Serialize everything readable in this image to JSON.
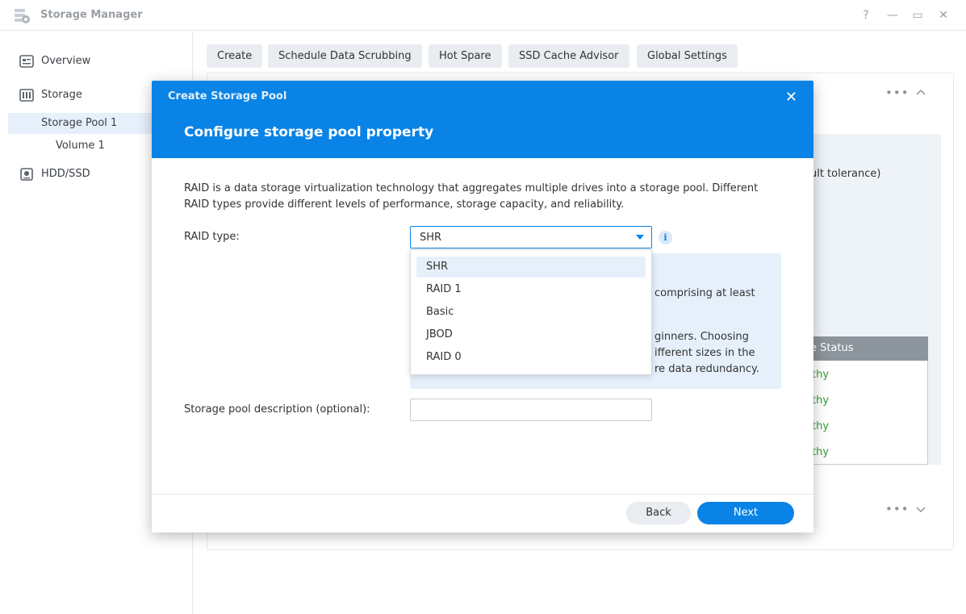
{
  "window": {
    "title": "Storage Manager",
    "controls": {
      "help": "?",
      "minimize": "—",
      "maximize": "▭",
      "close": "✕"
    }
  },
  "sidebar": {
    "overview": "Overview",
    "storage": "Storage",
    "storage_pool": "Storage Pool 1",
    "volume": "Volume 1",
    "hdd": "HDD/SSD"
  },
  "toolbar": {
    "create": "Create",
    "scrubbing": "Schedule Data Scrubbing",
    "hot_spare": "Hot Spare",
    "ssd_cache": "SSD Cache Advisor",
    "global_settings": "Global Settings"
  },
  "background": {
    "fault_tolerance_fragment": "ault tolerance)",
    "status_header_fragment": "e Status",
    "healthy_fragment": "thy",
    "dots": "•••"
  },
  "modal": {
    "small_title": "Create Storage Pool",
    "title": "Configure storage pool property",
    "close": "✕",
    "description": "RAID is a data storage virtualization technology that aggregates multiple drives into a storage pool. Different RAID types provide different levels of performance, storage capacity, and reliability.",
    "raid_label": "RAID type:",
    "raid_value": "SHR",
    "info_icon": "i",
    "info_fragments": {
      "line1": "comprising at least",
      "line2": "ginners. Choosing",
      "line3": "ifferent sizes in the",
      "line4": "re data redundancy."
    },
    "dropdown_options": [
      "SHR",
      "RAID 1",
      "Basic",
      "JBOD",
      "RAID 0"
    ],
    "selected_option": "SHR",
    "desc_label": "Storage pool description (optional):",
    "desc_value": "",
    "back": "Back",
    "next": "Next"
  }
}
